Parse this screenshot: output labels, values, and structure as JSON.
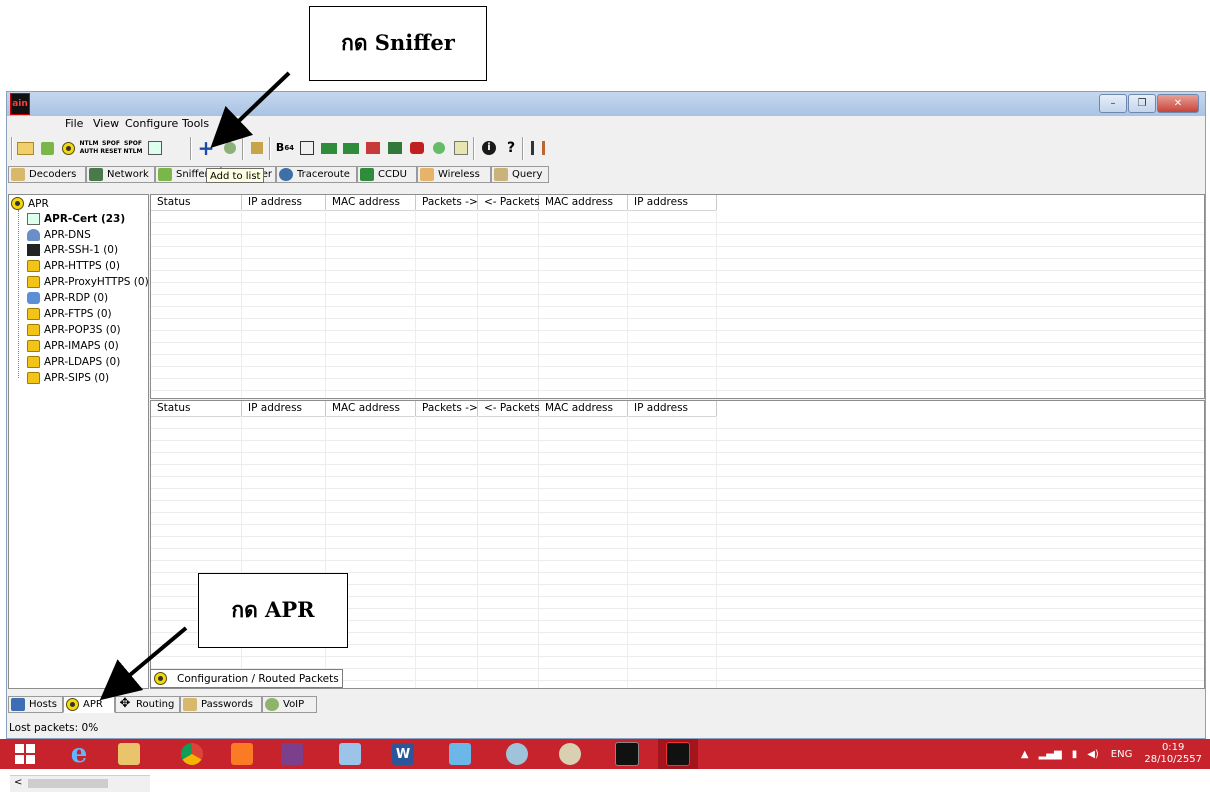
{
  "annotations": {
    "sniffer_note": "กด Sniffer",
    "apr_note": "กด APR"
  },
  "window": {
    "logo_text": "ain",
    "controls": {
      "minimize": "–",
      "maximize": "❐",
      "close": "✕"
    }
  },
  "menu": [
    "File",
    "View",
    "Configure",
    "Tools"
  ],
  "toolbar": {
    "tooltip": "Add to list",
    "base64_label": "B",
    "base64_sub": "64"
  },
  "top_tabs": [
    "Decoders",
    "Network",
    "Sniffer",
    "Cracker",
    "Traceroute",
    "CCDU",
    "Wireless",
    "Query"
  ],
  "tree": {
    "root": "APR",
    "items": [
      "APR-Cert (23)",
      "APR-DNS",
      "APR-SSH-1 (0)",
      "APR-HTTPS (0)",
      "APR-ProxyHTTPS (0)",
      "APR-RDP (0)",
      "APR-FTPS (0)",
      "APR-POP3S (0)",
      "APR-IMAPS (0)",
      "APR-LDAPS (0)",
      "APR-SIPS (0)"
    ]
  },
  "columns": [
    "Status",
    "IP address",
    "MAC address",
    "Packets ->",
    "<- Packets",
    "MAC address",
    "IP address"
  ],
  "bottom_panel_tab": "Configuration / Routed Packets",
  "bottom_tabs": [
    "Hosts",
    "APR",
    "Routing",
    "Passwords",
    "VoIP"
  ],
  "status": "Lost packets:  0%",
  "taskbar": {
    "language": "ENG",
    "time": "0:19",
    "date": "28/10/2557"
  }
}
